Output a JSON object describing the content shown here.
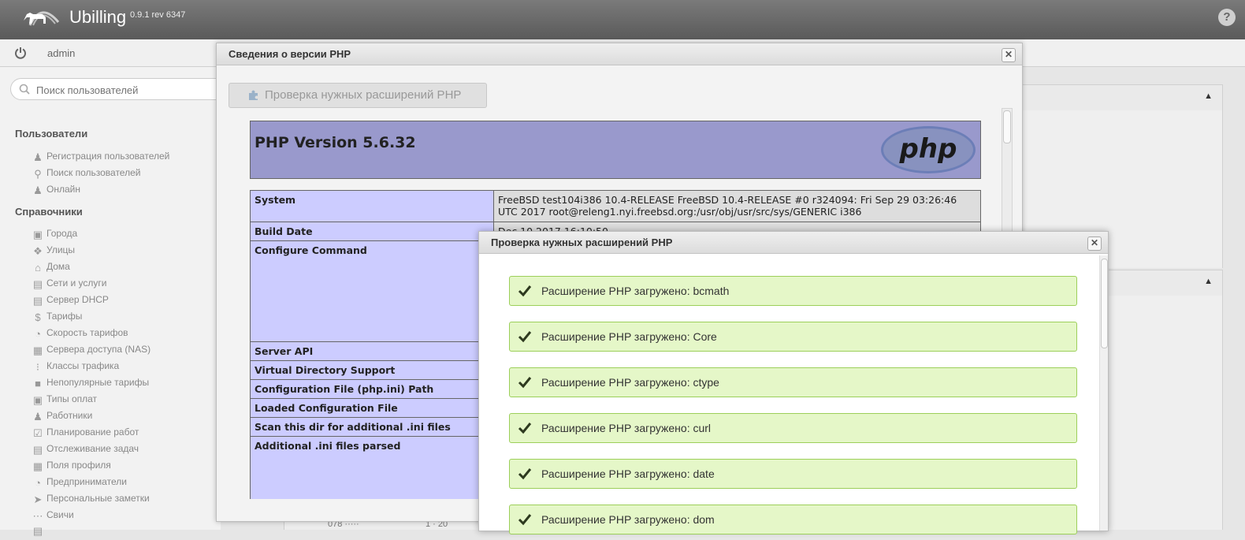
{
  "header": {
    "app_title": "Ubilling",
    "version": "0.9.1 rev 6347",
    "help": "?"
  },
  "userbar": {
    "username": "admin"
  },
  "sidebar": {
    "search_placeholder": "Поиск пользователей",
    "sections": [
      {
        "title": "Пользователи",
        "items": [
          {
            "label": "Регистрация пользователей",
            "icon": "user-add-icon"
          },
          {
            "label": "Поиск пользователей",
            "icon": "magnifier-icon"
          },
          {
            "label": "Онлайн",
            "icon": "users-online-icon"
          }
        ]
      },
      {
        "title": "Справочники",
        "items": [
          {
            "label": "Города",
            "icon": "city-icon"
          },
          {
            "label": "Улицы",
            "icon": "signpost-icon"
          },
          {
            "label": "Дома",
            "icon": "house-icon"
          },
          {
            "label": "Сети и услуги",
            "icon": "network-icon"
          },
          {
            "label": "Сервер DHCP",
            "icon": "server-icon"
          },
          {
            "label": "Тарифы",
            "icon": "dollar-icon"
          },
          {
            "label": "Скорость тарифов",
            "icon": "speedometer-icon"
          },
          {
            "label": "Сервера доступа (NAS)",
            "icon": "nas-icon"
          },
          {
            "label": "Классы трафика",
            "icon": "traffic-light-icon"
          },
          {
            "label": "Непопулярные тарифы",
            "icon": "unpopular-icon"
          },
          {
            "label": "Типы оплат",
            "icon": "payment-icon"
          },
          {
            "label": "Работники",
            "icon": "worker-icon"
          },
          {
            "label": "Планирование работ",
            "icon": "clipboard-icon"
          },
          {
            "label": "Отслеживание задач",
            "icon": "tasks-icon"
          },
          {
            "label": "Поля профиля",
            "icon": "profile-fields-icon"
          },
          {
            "label": "Предприниматели",
            "icon": "pie-icon"
          },
          {
            "label": "Персональные заметки",
            "icon": "pin-icon"
          },
          {
            "label": "Свичи",
            "icon": "switch-icon"
          }
        ]
      }
    ]
  },
  "background": {
    "strip_left": "078 ·····",
    "strip_right": "1 · 20"
  },
  "dialog_phpinfo": {
    "title": "Сведения о версии PHP",
    "check_button": "Проверка нужных расширений PHP",
    "php_version": "PHP Version 5.6.32",
    "rows": [
      {
        "key": "System",
        "value": "FreeBSD test104i386 10.4-RELEASE FreeBSD 10.4-RELEASE #0 r324094: Fri Sep 29 03:26:46 UTC 2017 root@releng1.nyi.freebsd.org:/usr/obj/usr/src/sys/GENERIC i386"
      },
      {
        "key": "Build Date",
        "value": "Dec 10 2017 16:10:50"
      },
      {
        "key": "Configure Command",
        "value": ""
      },
      {
        "key": "Server API",
        "value": ""
      },
      {
        "key": "Virtual Directory Support",
        "value": ""
      },
      {
        "key": "Configuration File (php.ini) Path",
        "value": ""
      },
      {
        "key": "Loaded Configuration File",
        "value": ""
      },
      {
        "key": "Scan this dir for additional .ini files",
        "value": ""
      },
      {
        "key": "Additional .ini files parsed",
        "value": ""
      }
    ]
  },
  "dialog_extensions": {
    "title": "Проверка нужных расширений PHP",
    "items": [
      "Расширение PHP загружено: bcmath",
      "Расширение PHP загружено: Core",
      "Расширение PHP загружено: ctype",
      "Расширение PHP загружено: curl",
      "Расширение PHP загружено: date",
      "Расширение PHP загружено: dom"
    ]
  }
}
